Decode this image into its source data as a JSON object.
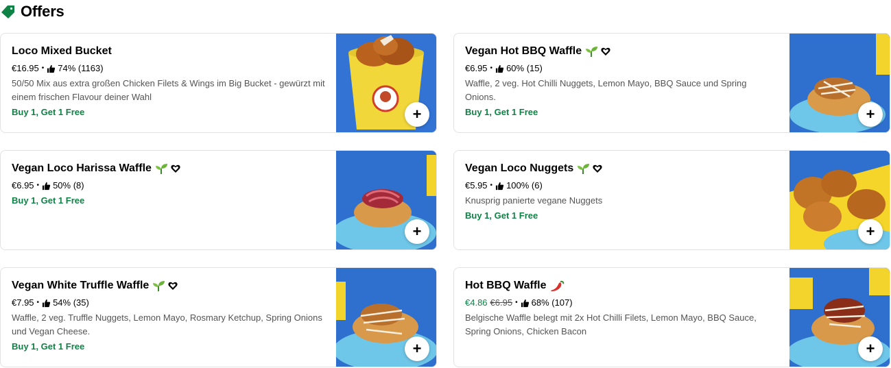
{
  "section": {
    "title": "Offers",
    "icon": "tag-icon"
  },
  "items": [
    {
      "name": "Loco Mixed Bucket",
      "price": "€16.95",
      "rating": "74% (1163)",
      "description": "50/50 Mix aus extra großen Chicken Filets & Wings im Big Bucket - gewürzt mit einem frischen Flavour deiner Wahl",
      "promo": "Buy 1, Get 1 Free",
      "add_label": "+"
    },
    {
      "name": "Vegan Hot BBQ Waffle",
      "price": "€6.95",
      "rating": "60% (15)",
      "description": "Waffle, 2 veg. Hot Chilli Nuggets, Lemon Mayo, BBQ Sauce und Spring Onions.",
      "promo": "Buy 1, Get 1 Free",
      "add_label": "+"
    },
    {
      "name": "Vegan Loco Harissa Waffle",
      "price": "€6.95",
      "rating": "50% (8)",
      "promo": "Buy 1, Get 1 Free",
      "add_label": "+"
    },
    {
      "name": "Vegan Loco Nuggets",
      "price": "€5.95",
      "rating": "100% (6)",
      "description": "Knusprig panierte vegane Nuggets",
      "promo": "Buy 1, Get 1 Free",
      "add_label": "+"
    },
    {
      "name": "Vegan White Truffle Waffle",
      "price": "€7.95",
      "rating": "54% (35)",
      "description": "Waffle, 2 veg. Truffle Nuggets, Lemon Mayo, Rosmary Ketchup, Spring Onions und Vegan Cheese.",
      "promo": "Buy 1, Get 1 Free",
      "add_label": "+"
    },
    {
      "name": "Hot BBQ Waffle",
      "sale_price": "€4.86",
      "original_price": "€6.95",
      "rating": "68% (107)",
      "description": "Belgische Waffle belegt mit 2x Hot Chilli Filets, Lemon Mayo, BBQ Sauce, Spring Onions, Chicken Bacon",
      "add_label": "+"
    }
  ],
  "colors": {
    "green": "#0e8345",
    "photo_bg": "#2f6fce",
    "border": "#e2e2e2"
  }
}
